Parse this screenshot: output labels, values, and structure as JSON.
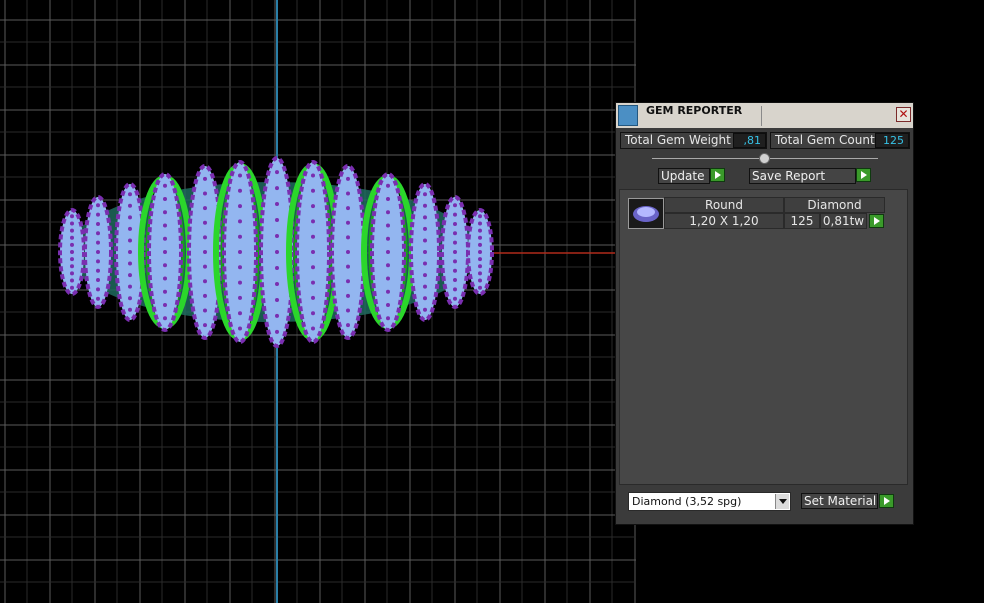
{
  "panel": {
    "title": "GEM REPORTER",
    "close_glyph": "✕",
    "total_weight_label": "Total Gem Weight",
    "total_weight_value": ",81",
    "total_count_label": "Total Gem Count",
    "total_count_value": "125",
    "update_label": "Update",
    "save_report_label": "Save Report",
    "table": {
      "headers": [
        "Round",
        "Diamond"
      ],
      "rows": [
        {
          "size": "1,20 X 1,20",
          "count": "125",
          "weight": "0,81tw"
        }
      ]
    },
    "material_select_value": "Diamond     (3,52 spg)",
    "set_material_label": "Set Material"
  },
  "colors": {
    "axis_blue": "#2a7fa8",
    "axis_red": "#b02a1a",
    "grid": "#5a5a5a",
    "gem_purple": "#7a2eb0",
    "gem_blue": "#93b6f0",
    "ring_green": "#2bd62b",
    "value_cyan": "#36c2e6",
    "play_green": "#3a9a2a"
  },
  "icons": [
    "gem-reporter-app-icon",
    "close-icon",
    "play-arrow-icon",
    "gem-thumbnail-icon",
    "dropdown-arrow-icon"
  ]
}
